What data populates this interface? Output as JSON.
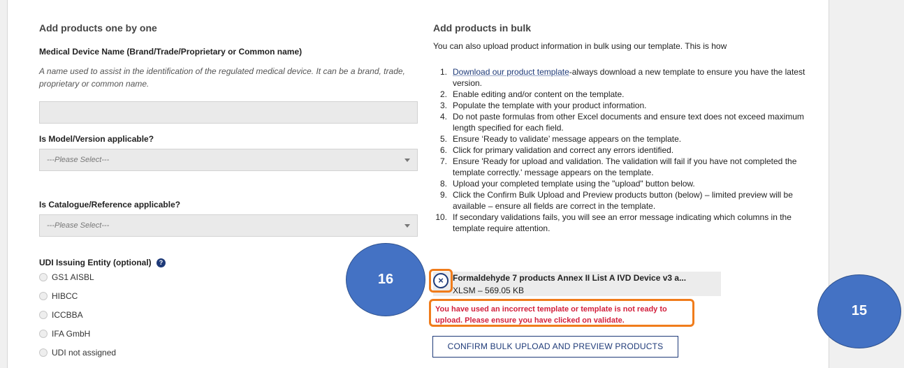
{
  "left_section": {
    "title": "Add products one by one",
    "device_name_label": "Medical Device Name (Brand/Trade/Proprietary or Common name)",
    "device_name_hint": "A name used to assist in the identification of the regulated medical device. It can be a brand, trade, proprietary or common name.",
    "device_name_value": "",
    "model_label": "Is Model/Version applicable?",
    "model_select_value": "---Please Select---",
    "catalogue_label": "Is Catalogue/Reference applicable?",
    "catalogue_select_value": "---Please Select---",
    "udi_label": "UDI Issuing Entity (optional)",
    "udi_help_icon": "question-circle",
    "udi_options": [
      "GS1 AISBL",
      "HIBCC",
      "ICCBBA",
      "IFA GmbH",
      "UDI not assigned"
    ]
  },
  "right_section": {
    "title": "Add products in bulk",
    "intro": "You can also upload product information in bulk using our template. This is how",
    "steps": [
      {
        "num": "1.",
        "link": "Download our product template",
        "text": "-always download a new template to ensure you have the latest version."
      },
      {
        "num": "2.",
        "text": "Enable editing and/or content on the template."
      },
      {
        "num": "3.",
        "text": "Populate the template with your product information."
      },
      {
        "num": "4.",
        "text": "Do not paste formulas from other Excel documents and ensure text does not exceed maximum length specified for each field."
      },
      {
        "num": "5.",
        "text": "Ensure ‘Ready to validate’ message appears on the template."
      },
      {
        "num": "6.",
        "text": "Click for primary validation and correct any errors identified."
      },
      {
        "num": "7.",
        "text": "Ensure 'Ready for upload and validation. The validation will fail if you have not completed the template correctly.' message appears on the template."
      },
      {
        "num": "8.",
        "text": "Upload your completed template using the \"upload\" button below."
      },
      {
        "num": "9.",
        "text": "Click the Confirm Bulk Upload and Preview products button (below) – limited preview will be available – ensure all fields are correct in the template."
      },
      {
        "num": "10.",
        "text": "If secondary validations fails, you will see an error message indicating which columns in the template require attention."
      }
    ],
    "file": {
      "name": "Formaldehyde 7 products Annex II List A IVD Device v3 a...",
      "meta": "XLSM – 569.05 KB",
      "remove_icon": "close-circle"
    },
    "error_message": "You have used an incorrect template or template is not ready to upload. Please ensure you have clicked on validate.",
    "confirm_button": "CONFIRM BULK UPLOAD AND PREVIEW PRODUCTS"
  },
  "annotations": {
    "callout_16": "16",
    "callout_15": "15",
    "callout_color": "#4472c4",
    "highlight_color": "#f07c1b"
  },
  "colors": {
    "brand_navy": "#1e3a78",
    "error_red": "#d21f3c"
  }
}
